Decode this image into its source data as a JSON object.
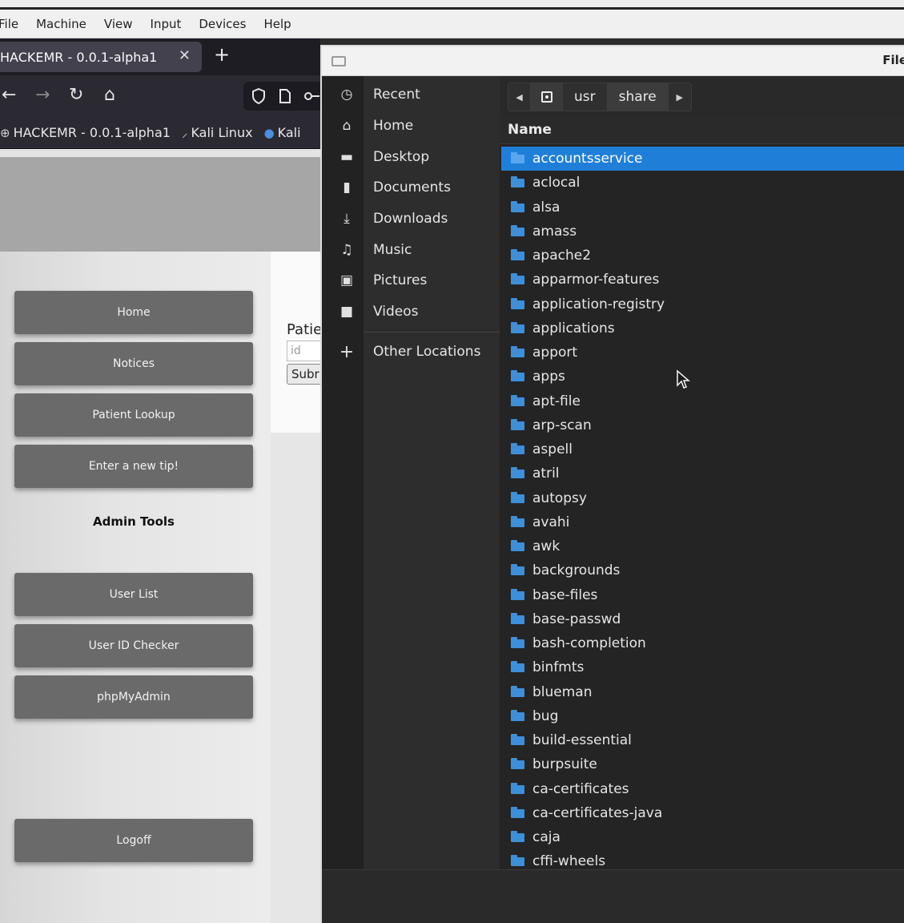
{
  "vm_menu": {
    "items": [
      "File",
      "Machine",
      "View",
      "Input",
      "Devices",
      "Help"
    ]
  },
  "browser": {
    "tab_title": "HACKEMR - 0.0.1-alpha1",
    "tab_close_icon": "close-icon",
    "new_tab_icon": "plus-icon",
    "nav_icons": [
      "back-arrow-icon",
      "forward-arrow-icon",
      "reload-icon",
      "home-icon",
      "shield-icon",
      "page-icon",
      "key-icon"
    ],
    "bookmarks": [
      {
        "icon": "globe-icon",
        "label": "HACKEMR - 0.0.1-alpha1"
      },
      {
        "icon": "kali-dragon-icon",
        "label": "Kali Linux"
      },
      {
        "icon": "kali-tools-icon",
        "label": "Kali"
      }
    ]
  },
  "webpage": {
    "nav_buttons": [
      "Home",
      "Notices",
      "Patient Lookup",
      "Enter a new tip!"
    ],
    "admin_title": "Admin Tools",
    "admin_buttons": [
      "User List",
      "User ID Checker",
      "phpMyAdmin"
    ],
    "logoff_label": "Logoff",
    "patient_label": "Patie",
    "patient_input_placeholder": "id",
    "patient_submit_label": "Subr"
  },
  "file_dialog": {
    "title": "File",
    "places": [
      {
        "icon": "clock-icon",
        "label": "Recent"
      },
      {
        "icon": "home-icon",
        "label": "Home"
      },
      {
        "icon": "desktop-icon",
        "label": "Desktop"
      },
      {
        "icon": "document-icon",
        "label": "Documents"
      },
      {
        "icon": "download-icon",
        "label": "Downloads"
      },
      {
        "icon": "music-icon",
        "label": "Music"
      },
      {
        "icon": "pictures-icon",
        "label": "Pictures"
      },
      {
        "icon": "video-icon",
        "label": "Videos"
      }
    ],
    "other_locations": {
      "icon": "plus-icon",
      "label": "Other Locations"
    },
    "path": [
      "usr",
      "share"
    ],
    "active_path_segment": "share",
    "column_name": "Name",
    "selected_item": "accountsservice",
    "folders": [
      "accountsservice",
      "aclocal",
      "alsa",
      "amass",
      "apache2",
      "apparmor-features",
      "application-registry",
      "applications",
      "apport",
      "apps",
      "apt-file",
      "arp-scan",
      "aspell",
      "atril",
      "autopsy",
      "avahi",
      "awk",
      "backgrounds",
      "base-files",
      "base-passwd",
      "bash-completion",
      "binfmts",
      "blueman",
      "bug",
      "build-essential",
      "burpsuite",
      "ca-certificates",
      "ca-certificates-java",
      "caja",
      "cffi-wheels"
    ],
    "accent_color": "#1f7fd8",
    "folder_color": "#3d8fd9"
  }
}
